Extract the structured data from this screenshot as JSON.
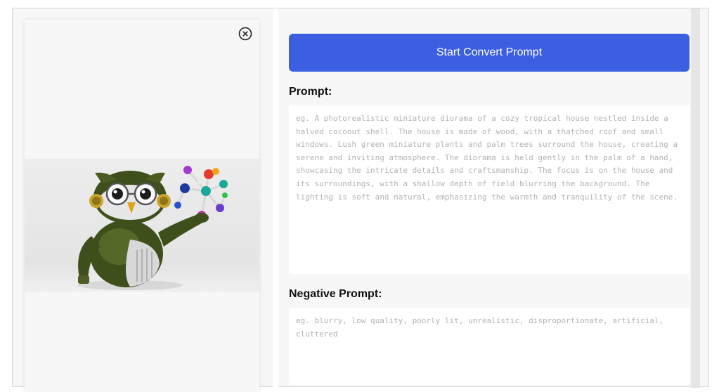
{
  "left": {
    "close_icon": "circle-x-icon",
    "image_alt": "robot-owl-holding-molecule"
  },
  "right": {
    "convert_button_label": "Start Convert Prompt",
    "prompt_label": "Prompt:",
    "prompt_placeholder": "eg. A photorealistic miniature diorama of a cozy tropical house nestled inside a halved coconut shell. The house is made of wood, with a thatched roof and small windows. Lush green miniature plants and palm trees surround the house, creating a serene and inviting atmosphere. The diorama is held gently in the palm of a hand, showcasing the intricate details and craftsmanship. The focus is on the house and its surroundings, with a shallow depth of field blurring the background. The lighting is soft and natural, emphasizing the warmth and tranquility of the scene.",
    "negative_label": "Negative Prompt:",
    "negative_placeholder": "eg. blurry, low quality, poorly lit, unrealistic, disproportionate, artificial, cluttered"
  },
  "colors": {
    "accent": "#3b5fe0",
    "panel_bg": "#f7f7f7"
  }
}
